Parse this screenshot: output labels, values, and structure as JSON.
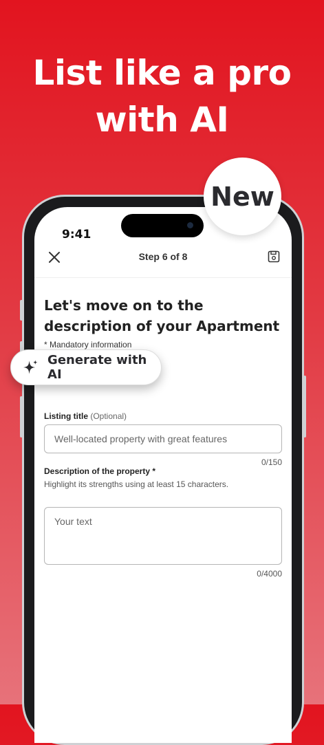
{
  "headline": {
    "line1": "List like a pro",
    "line2": "with AI"
  },
  "badge": {
    "label": "New"
  },
  "status_bar": {
    "time": "9:41"
  },
  "topbar": {
    "step": "Step 6 of 8",
    "close_icon": "close-icon",
    "save_icon": "save-icon"
  },
  "form": {
    "title": "Let's move on to the description of your Apartment",
    "mandatory_note": "* Mandatory information",
    "generate_button": {
      "label": "Generate with AI",
      "icon": "sparkle-icon"
    },
    "listing_title": {
      "label": "Listing title",
      "optional": "(Optional)",
      "value": "Well-located property with great features",
      "counter": "0/150"
    },
    "description": {
      "label": "Description of the property *",
      "hint": "Highlight its strengths using at least 15 characters.",
      "placeholder": "Your text",
      "counter": "0/4000"
    }
  },
  "colors": {
    "background_top": "#e2141f",
    "background_bottom": "#e7727a",
    "text_dark": "#222222"
  }
}
